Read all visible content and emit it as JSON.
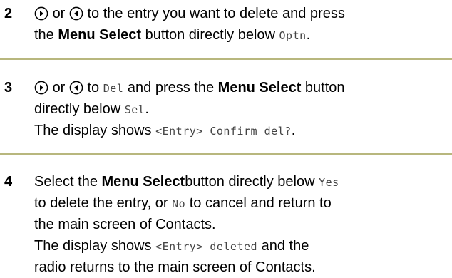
{
  "accent_color": "#b8b77e",
  "steps": [
    {
      "number": "2",
      "line1": {
        "or": "or",
        "after_icons": "to the entry you want to delete and press"
      },
      "line2": {
        "pre": "the",
        "bold": "Menu Select",
        "mid": "button directly below",
        "mono": "Optn",
        "end": "."
      }
    },
    {
      "number": "3",
      "line1": {
        "or": "or",
        "to": "to",
        "mono": "Del",
        "and_press": "and press the",
        "bold": "Menu Select",
        "end": "button"
      },
      "line2": {
        "pre": "directly below",
        "mono": "Sel",
        "end": "."
      },
      "line3": {
        "pre": "The display shows",
        "mono": "<Entry> Confirm del?",
        "end": "."
      }
    },
    {
      "number": "4",
      "line1": {
        "pre": "Select the",
        "bold": "Menu Select",
        "mid": "button directly below",
        "mono": "Yes"
      },
      "line2": {
        "pre": "to delete the entry, or",
        "mono": "No",
        "end": "to cancel and return to"
      },
      "line3": "the main screen of Contacts.",
      "line4": {
        "pre": "The display shows",
        "mono": "<Entry> deleted",
        "end": "and the"
      },
      "line5": "radio returns to the main screen of Contacts."
    }
  ],
  "icons": [
    "nav-right-icon",
    "nav-left-icon"
  ]
}
